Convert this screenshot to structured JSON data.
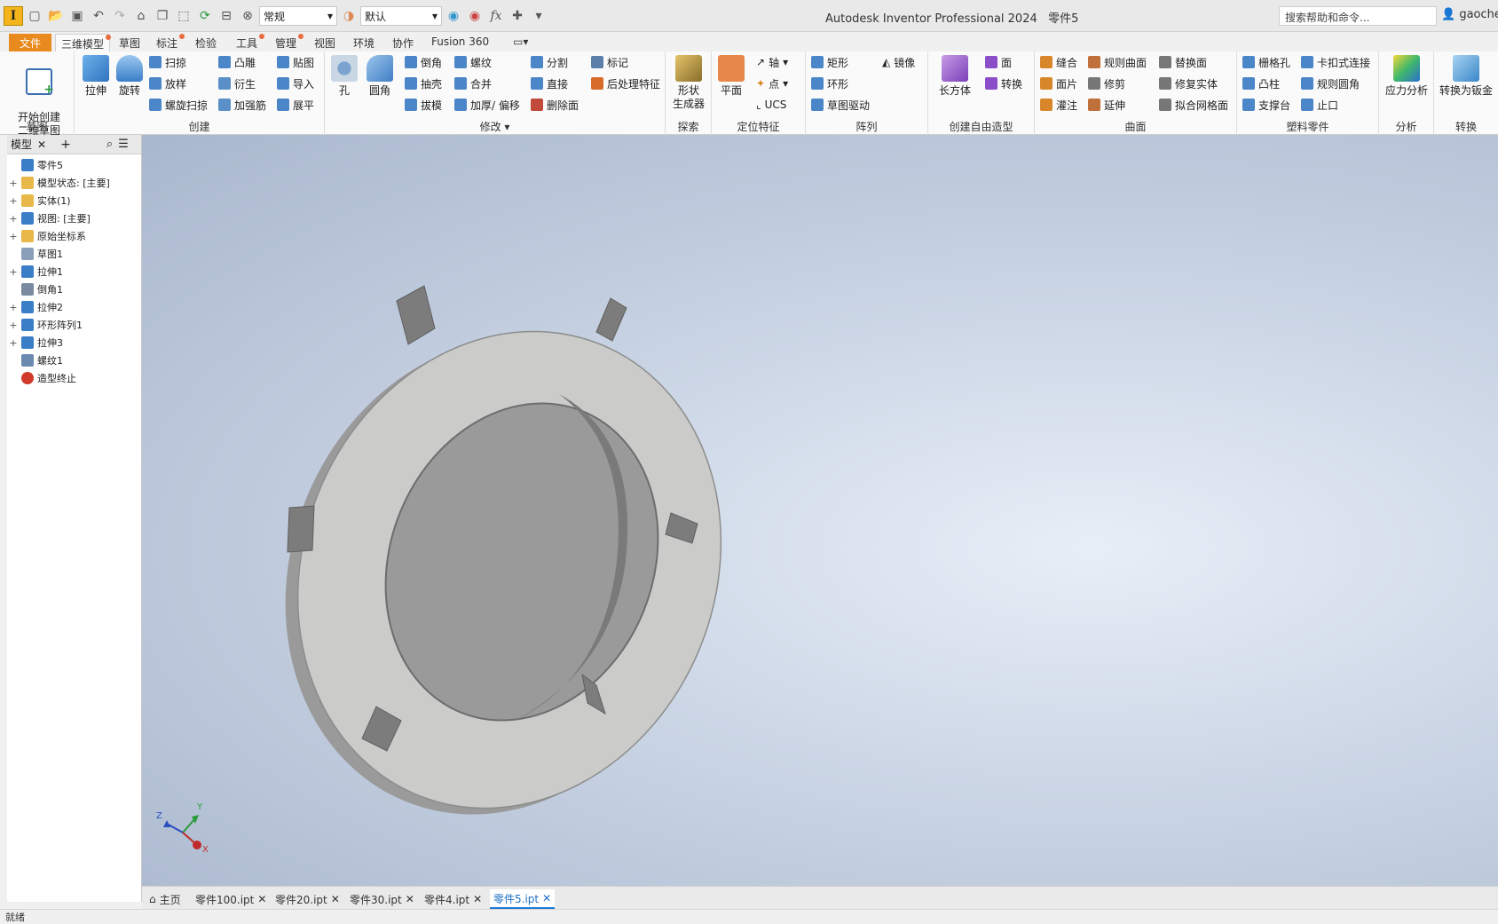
{
  "app": {
    "title": "Autodesk Inventor Professional 2024",
    "document": "零件5",
    "logo_letter": "I",
    "help_search": "搜索帮助和命令...",
    "user": "gaoche"
  },
  "qat": {
    "style_combo": "常规",
    "appearance_combo": "默认"
  },
  "menu_tabs": [
    "文件",
    "三维模型",
    "草图",
    "标注",
    "检验",
    "工具",
    "管理",
    "视图",
    "环境",
    "协作",
    "Fusion 360"
  ],
  "ribbon": {
    "sketch": {
      "title": "草图",
      "start_sketch": "开始创建\n二维草图"
    },
    "create": {
      "title": "创建",
      "extrude": "拉伸",
      "revolve": "旋转",
      "sweep": "扫掠",
      "loft": "放样",
      "coil": "螺旋扫掠",
      "emboss": "凸雕",
      "derive": "衍生",
      "rib": "加强筋",
      "decal": "贴图",
      "import": "导入",
      "unfold": "展平"
    },
    "modify": {
      "title": "修改",
      "hole": "孔",
      "fillet": "圆角",
      "chamfer": "倒角",
      "shell": "抽壳",
      "draft": "拔模",
      "thread": "螺纹",
      "combine": "合并",
      "thicken": "加厚/ 偏移",
      "split": "分割",
      "direct": "直接",
      "delete_face": "删除面",
      "mark": "标记",
      "post_feature": "后处理特征"
    },
    "explore": {
      "title": "探索",
      "shape_gen": "形状\n生成器"
    },
    "work": {
      "title": "定位特征",
      "plane": "平面",
      "axis": "轴",
      "point": "点",
      "ucs": "UCS"
    },
    "pattern": {
      "title": "阵列",
      "rect": "矩形",
      "circ": "环形",
      "sketch_driven": "草图驱动",
      "mirror": "镜像"
    },
    "freeform": {
      "title": "创建自由造型",
      "box": "长方体",
      "face": "面",
      "convert": "转换"
    },
    "surface": {
      "title": "曲面",
      "stitch": "缝合",
      "patch": "面片",
      "sculpt": "灌注",
      "ruled": "规则曲面",
      "trim": "修剪",
      "extend": "延伸",
      "replace": "替换面",
      "repair": "修复实体",
      "fit_mesh": "拟合网格面"
    },
    "plastic": {
      "title": "塑料零件",
      "grill": "栅格孔",
      "boss": "凸柱",
      "rest": "支撑台",
      "snap": "卡扣式连接",
      "rule_fillet": "规则圆角",
      "lip": "止口"
    },
    "analysis": {
      "title": "分析",
      "stress": "应力分析"
    },
    "convert": {
      "title": "转换",
      "to_sheet": "转换为钣金"
    }
  },
  "browser": {
    "tab_label": "模型",
    "items": [
      {
        "label": "零件5",
        "indent": 0,
        "expand": ""
      },
      {
        "label": "模型状态: [主要]",
        "indent": 1,
        "expand": "+"
      },
      {
        "label": "实体(1)",
        "indent": 1,
        "expand": "+"
      },
      {
        "label": "视图: [主要]",
        "indent": 1,
        "expand": "+"
      },
      {
        "label": "原始坐标系",
        "indent": 1,
        "expand": "+"
      },
      {
        "label": "草图1",
        "indent": 1,
        "expand": ""
      },
      {
        "label": "拉伸1",
        "indent": 1,
        "expand": "+"
      },
      {
        "label": "倒角1",
        "indent": 1,
        "expand": ""
      },
      {
        "label": "拉伸2",
        "indent": 1,
        "expand": "+"
      },
      {
        "label": "环形阵列1",
        "indent": 1,
        "expand": "+"
      },
      {
        "label": "拉伸3",
        "indent": 1,
        "expand": "+"
      },
      {
        "label": "螺纹1",
        "indent": 1,
        "expand": ""
      },
      {
        "label": "造型终止",
        "indent": 1,
        "expand": ""
      }
    ]
  },
  "triad": {
    "x": "X",
    "y": "Y",
    "z": "Z"
  },
  "doc_tabs": {
    "home": "主页",
    "tabs": [
      "零件100.ipt",
      "零件20.ipt",
      "零件30.ipt",
      "零件4.ipt",
      "零件5.ipt"
    ],
    "active": "零件5.ipt"
  },
  "status": "就绪",
  "colors": {
    "file_tab": "#e88a1d",
    "accent": "#1e7bd6",
    "part": "#c9c9c8"
  }
}
